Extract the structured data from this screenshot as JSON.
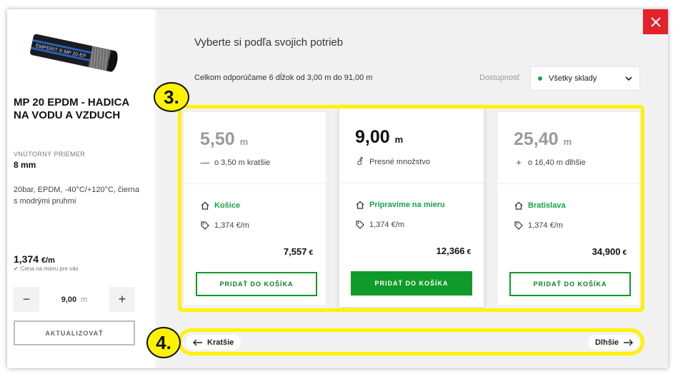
{
  "product": {
    "name": "MP 20 EPDM - HADICA NA VODU A VZDUCH",
    "inner_diameter_label": "VNÚTORNÝ PRIEMER",
    "inner_diameter_value": "8 mm",
    "description": "20bar, EPDM, -40°C/+120°C, čierna s modrými pruhmi",
    "image_text": "EMPERIT ® MP 20-EP",
    "unit_price": "1,374",
    "unit_price_suffix": "€/m",
    "price_note": "Cena na mieru pre vás",
    "quantity_value": "9,00",
    "quantity_unit": "m",
    "minus_label": "−",
    "plus_label": "+",
    "update_label": "AKTUALIZOVAŤ"
  },
  "panel": {
    "heading": "Vyberte si podľa svojich potrieb",
    "recommend_text": "Celkom odporúčame 6 dĺžok od 3,00 m do 91,00 m",
    "availability_label": "Dostupnosť",
    "availability_value": "Všetky sklady",
    "close_label": "×"
  },
  "cards": [
    {
      "length": "5,50",
      "unit": "m",
      "diff_icon": "minus-icon",
      "diff_text": "o 3,50 m kratšie",
      "store": "Košice",
      "price_per_m": "1,374 €/m",
      "total": "7,557",
      "currency": "€",
      "add_label": "PRIDAŤ DO KOŠÍKA"
    },
    {
      "length": "9,00",
      "unit": "m",
      "diff_icon": "gender-exact-icon",
      "diff_text": "Presné množstvo",
      "store": "Pripravíme na mieru",
      "price_per_m": "1,374 €/m",
      "total": "12,366",
      "currency": "€",
      "add_label": "PRIDAŤ DO KOŠÍKA"
    },
    {
      "length": "25,40",
      "unit": "m",
      "diff_icon": "plus-icon",
      "diff_text": "o 16,40 m dlhšie",
      "store": "Bratislava",
      "price_per_m": "1,374 €/m",
      "total": "34,900",
      "currency": "€",
      "add_label": "PRIDAŤ DO KOŠÍKA"
    }
  ],
  "pager": {
    "prev_label": "Kratšie",
    "next_label": "Dlhšie"
  },
  "annotations": {
    "badge_3": "3.",
    "badge_4": "4.",
    "highlight_color": "#fff200"
  },
  "colors": {
    "accent_green": "#0f9a2a",
    "close_red": "#e4222b"
  }
}
